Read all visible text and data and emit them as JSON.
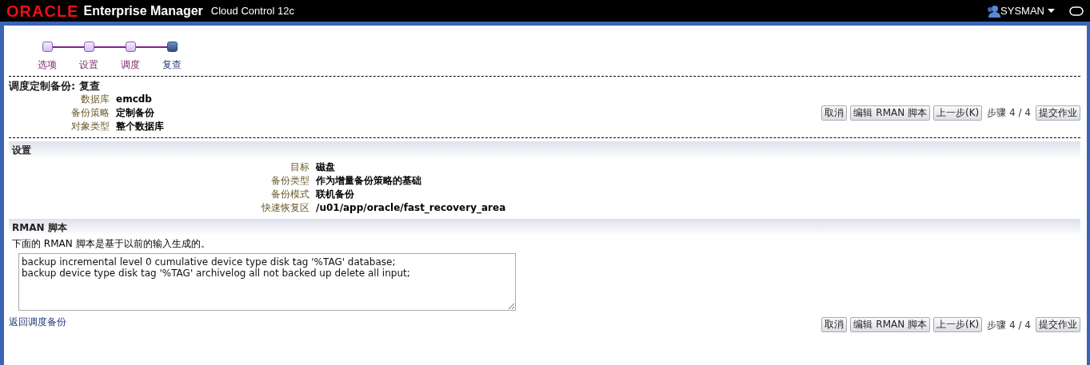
{
  "header": {
    "logo": "ORACLE",
    "product": "Enterprise Manager",
    "subtitle": "Cloud Control 12c",
    "user": "SYSMAN"
  },
  "train": [
    {
      "label": "选项",
      "selected": false
    },
    {
      "label": "设置",
      "selected": false
    },
    {
      "label": "调度",
      "selected": false
    },
    {
      "label": "复查",
      "selected": true
    }
  ],
  "page_title": "调度定制备份: 复查",
  "summary": [
    {
      "label": "数据库",
      "value": "emcdb"
    },
    {
      "label": "备份策略",
      "value": "定制备份"
    },
    {
      "label": "对象类型",
      "value": "整个数据库"
    }
  ],
  "top_actions": {
    "buttons": [
      "取消",
      "编辑 RMAN 脚本",
      "上一步(K)"
    ],
    "step_text": "步骤 4 / 4",
    "submit": "提交作业"
  },
  "settings": {
    "title": "设置",
    "fields": [
      {
        "label": "目标",
        "value": "磁盘"
      },
      {
        "label": "备份类型",
        "value": "作为增量备份策略的基础"
      },
      {
        "label": "备份模式",
        "value": "联机备份"
      },
      {
        "label": "快速恢复区",
        "value": "/u01/app/oracle/fast_recovery_area"
      }
    ]
  },
  "rman": {
    "title": "RMAN 脚本",
    "description": "下面的 RMAN 脚本是基于以前的输入生成的。",
    "script": "backup incremental level 0 cumulative device type disk tag '%TAG' database;\nbackup device type disk tag '%TAG' archivelog all not backed up delete all input;"
  },
  "back_link": "返回调度备份",
  "bottom_actions": {
    "buttons": [
      "取消",
      "编辑 RMAN 脚本",
      "上一步(K)"
    ],
    "step_text": "步骤 4 / 4",
    "submit": "提交作业"
  }
}
